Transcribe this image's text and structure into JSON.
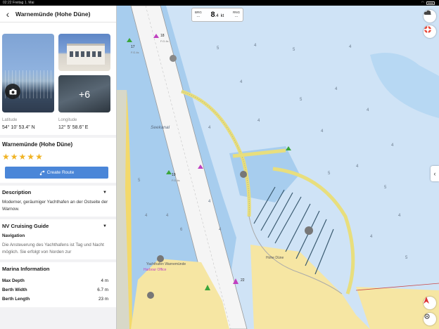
{
  "status": {
    "time": "02:22",
    "date": "Freitag 1. Mai",
    "battery": "battery-icon",
    "wifi": "wifi-icon"
  },
  "panel": {
    "title": "Warnemünde (Hohe Düne)",
    "back_icon": "chevron-left-icon",
    "photos_more": "+6",
    "latitude_label": "Latitude",
    "latitude_value": "54° 10' 53.4\" N",
    "longitude_label": "Longitude",
    "longitude_value": "12° 5' 58.6\" E",
    "name": "Warnemünde (Hohe Düne)",
    "rating": 5,
    "create_route_label": "Create Route",
    "description": {
      "title": "Description",
      "text": "Moderner, geräumiger Yachthafen an der Ostseite der Warnow."
    },
    "guide": {
      "title": "NV Cruising Guide",
      "subtitle": "Navigation",
      "text": "Die Ansteuerung des Yachthafens ist Tag und Nacht möglich. Sie erfolgt von Norden zur"
    },
    "marina_info": {
      "title": "Marina Information",
      "rows": [
        {
          "key": "Max Depth",
          "value": "4 m"
        },
        {
          "key": "Berth Width",
          "value": "6.7 m"
        },
        {
          "key": "Berth Length",
          "value": "23 m"
        }
      ]
    }
  },
  "hud": {
    "brg_label": "BRG",
    "brg_value": "---",
    "speed_value": "8",
    "speed_decimal": ".4",
    "speed_unit": "kt",
    "rng_label": "RNG",
    "rng_value": "---"
  },
  "map": {
    "channel_label": "Seekanal",
    "lights": [
      "18",
      "17",
      "19",
      "22"
    ],
    "light_codes": [
      "F.G.4s",
      "F.G.4s",
      "F.G.4s"
    ],
    "place_labels": [
      "Yachthafen Warnemünde",
      "Harbour Office",
      "Hohe Düne"
    ],
    "depth_labels": [
      "5",
      "4",
      "6",
      "7",
      "3",
      "4",
      "5",
      "4"
    ],
    "buttons": {
      "weather": "cloud-icon",
      "sos": "lifebuoy-icon",
      "collapse": "chevron-left-icon",
      "north": "compass-arrow-icon",
      "locate": "crosshair-icon"
    }
  },
  "colors": {
    "accent": "#4a86d8",
    "star": "#f0b324",
    "deep_water": "#cfe3f6",
    "shallow_water": "#a7cdee",
    "channel": "#f5f5f5",
    "land": "#f6e6a3"
  }
}
